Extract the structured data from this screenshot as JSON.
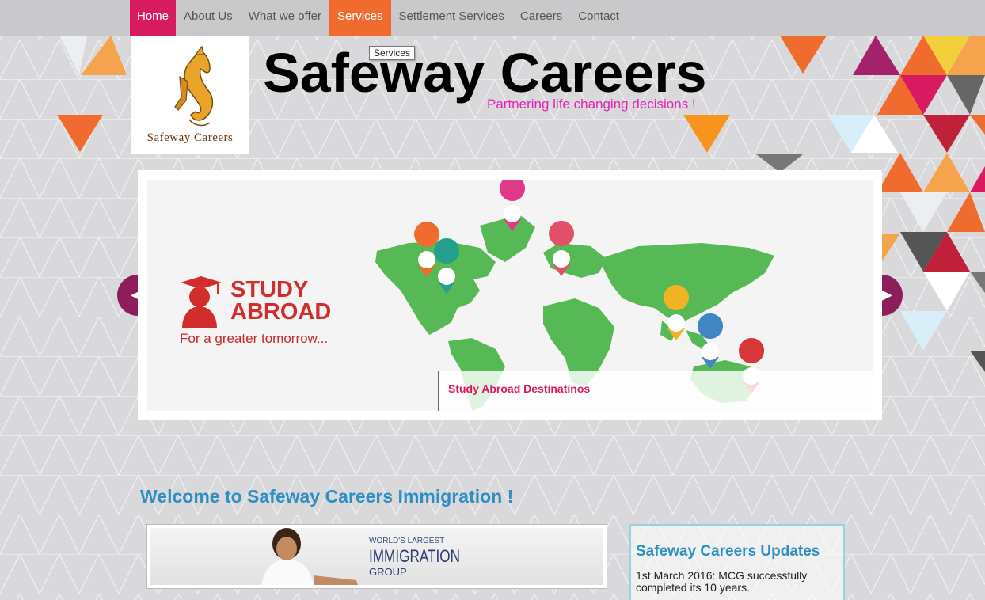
{
  "nav": {
    "items": [
      {
        "label": "Home"
      },
      {
        "label": "About Us"
      },
      {
        "label": "What we offer"
      },
      {
        "label": "Services"
      },
      {
        "label": "Settlement Services"
      },
      {
        "label": "Careers"
      },
      {
        "label": "Contact"
      }
    ],
    "tooltip": "Services"
  },
  "header": {
    "logo_text": "Safeway Careers",
    "title": "Safeway Careers",
    "tagline": "Partnering life changing decisions !"
  },
  "slider": {
    "headline_1": "STUDY",
    "headline_2": "ABROAD",
    "subline": "For a greater tomorrow...",
    "caption": "Study Abroad Destinatinos",
    "prev_icon": "chevron-left-icon",
    "next_icon": "chevron-right-icon"
  },
  "main": {
    "welcome": "Welcome to Safeway Careers Immigration !",
    "banner": {
      "line1": "WORLD'S LARGEST",
      "line2": "IMMIGRATION",
      "line3": "GROUP"
    }
  },
  "updates": {
    "title": "Safeway Careers Updates",
    "text": "1st March 2016: MCG successfully completed its 10 years."
  },
  "colors": {
    "home": "#d81b60",
    "services": "#ef6b2e",
    "accent_blue": "#2f8fc2",
    "tagline": "#e023b4",
    "map_green": "#57b956"
  }
}
